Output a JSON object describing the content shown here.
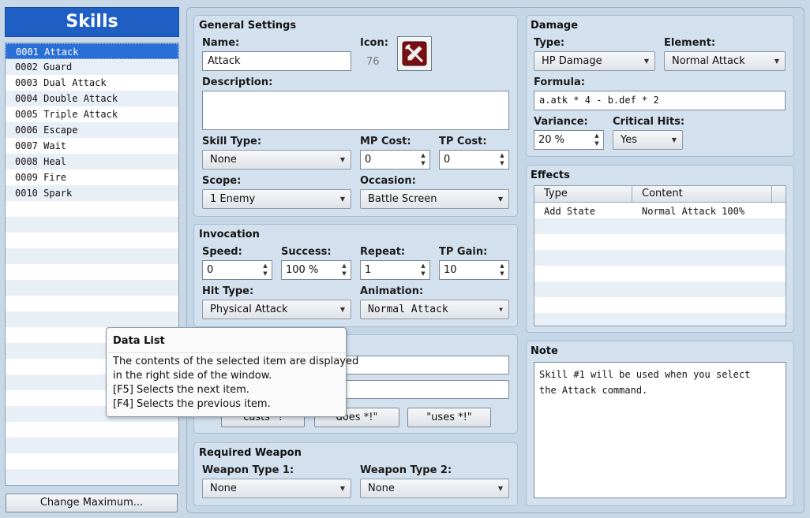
{
  "sidebar": {
    "title": "Skills",
    "items": [
      {
        "label": "0001 Attack",
        "selected": true
      },
      {
        "label": "0002 Guard"
      },
      {
        "label": "0003 Dual Attack"
      },
      {
        "label": "0004 Double Attack"
      },
      {
        "label": "0005 Triple Attack"
      },
      {
        "label": "0006 Escape"
      },
      {
        "label": "0007 Wait"
      },
      {
        "label": "0008 Heal"
      },
      {
        "label": "0009 Fire"
      },
      {
        "label": "0010 Spark"
      }
    ],
    "change_max_label": "Change Maximum..."
  },
  "general": {
    "title": "General Settings",
    "name_label": "Name:",
    "name_value": "Attack",
    "icon_label": "Icon:",
    "icon_index": "76",
    "icon_name": "sword-shield-icon",
    "description_label": "Description:",
    "description_value": "",
    "skill_type_label": "Skill Type:",
    "skill_type_value": "None",
    "mp_cost_label": "MP Cost:",
    "mp_cost_value": "0",
    "tp_cost_label": "TP Cost:",
    "tp_cost_value": "0",
    "scope_label": "Scope:",
    "scope_value": "1 Enemy",
    "occasion_label": "Occasion:",
    "occasion_value": "Battle Screen"
  },
  "invocation": {
    "title": "Invocation",
    "speed_label": "Speed:",
    "speed_value": "0",
    "success_label": "Success:",
    "success_value": "100 %",
    "repeat_label": "Repeat:",
    "repeat_value": "1",
    "tp_gain_label": "TP Gain:",
    "tp_gain_value": "10",
    "hit_type_label": "Hit Type:",
    "hit_type_value": "Physical Attack",
    "animation_label": "Animation:",
    "animation_value": "Normal Attack"
  },
  "message": {
    "btn1": "casts *!",
    "btn2": "does *!\"",
    "btn3": "\"uses *!\""
  },
  "required_weapon": {
    "title": "Required Weapon",
    "type1_label": "Weapon Type 1:",
    "type1_value": "None",
    "type2_label": "Weapon Type 2:",
    "type2_value": "None"
  },
  "damage": {
    "title": "Damage",
    "type_label": "Type:",
    "type_value": "HP Damage",
    "element_label": "Element:",
    "element_value": "Normal Attack",
    "formula_label": "Formula:",
    "formula_value": "a.atk * 4 - b.def * 2",
    "variance_label": "Variance:",
    "variance_value": "20 %",
    "critical_label": "Critical Hits:",
    "critical_value": "Yes"
  },
  "effects": {
    "title": "Effects",
    "col_type": "Type",
    "col_content": "Content",
    "rows": [
      {
        "type": "Add State",
        "content": "Normal Attack 100%"
      }
    ]
  },
  "note": {
    "title": "Note",
    "line1": "Skill #1 will be used when you select",
    "line2": "the Attack command."
  },
  "tooltip": {
    "title": "Data List",
    "line1": "The contents of the selected item are displayed",
    "line2": "in the right side of the window.",
    "line3": "[F5] Selects the next item.",
    "line4": "[F4] Selects the previous item."
  },
  "colors": {
    "accent": "#1f63c7",
    "title_bar": "#1d5fc3",
    "selection": "#2a6fd6",
    "panel_bg": "#d3e1ee",
    "window_bg": "#c9d8e7"
  }
}
